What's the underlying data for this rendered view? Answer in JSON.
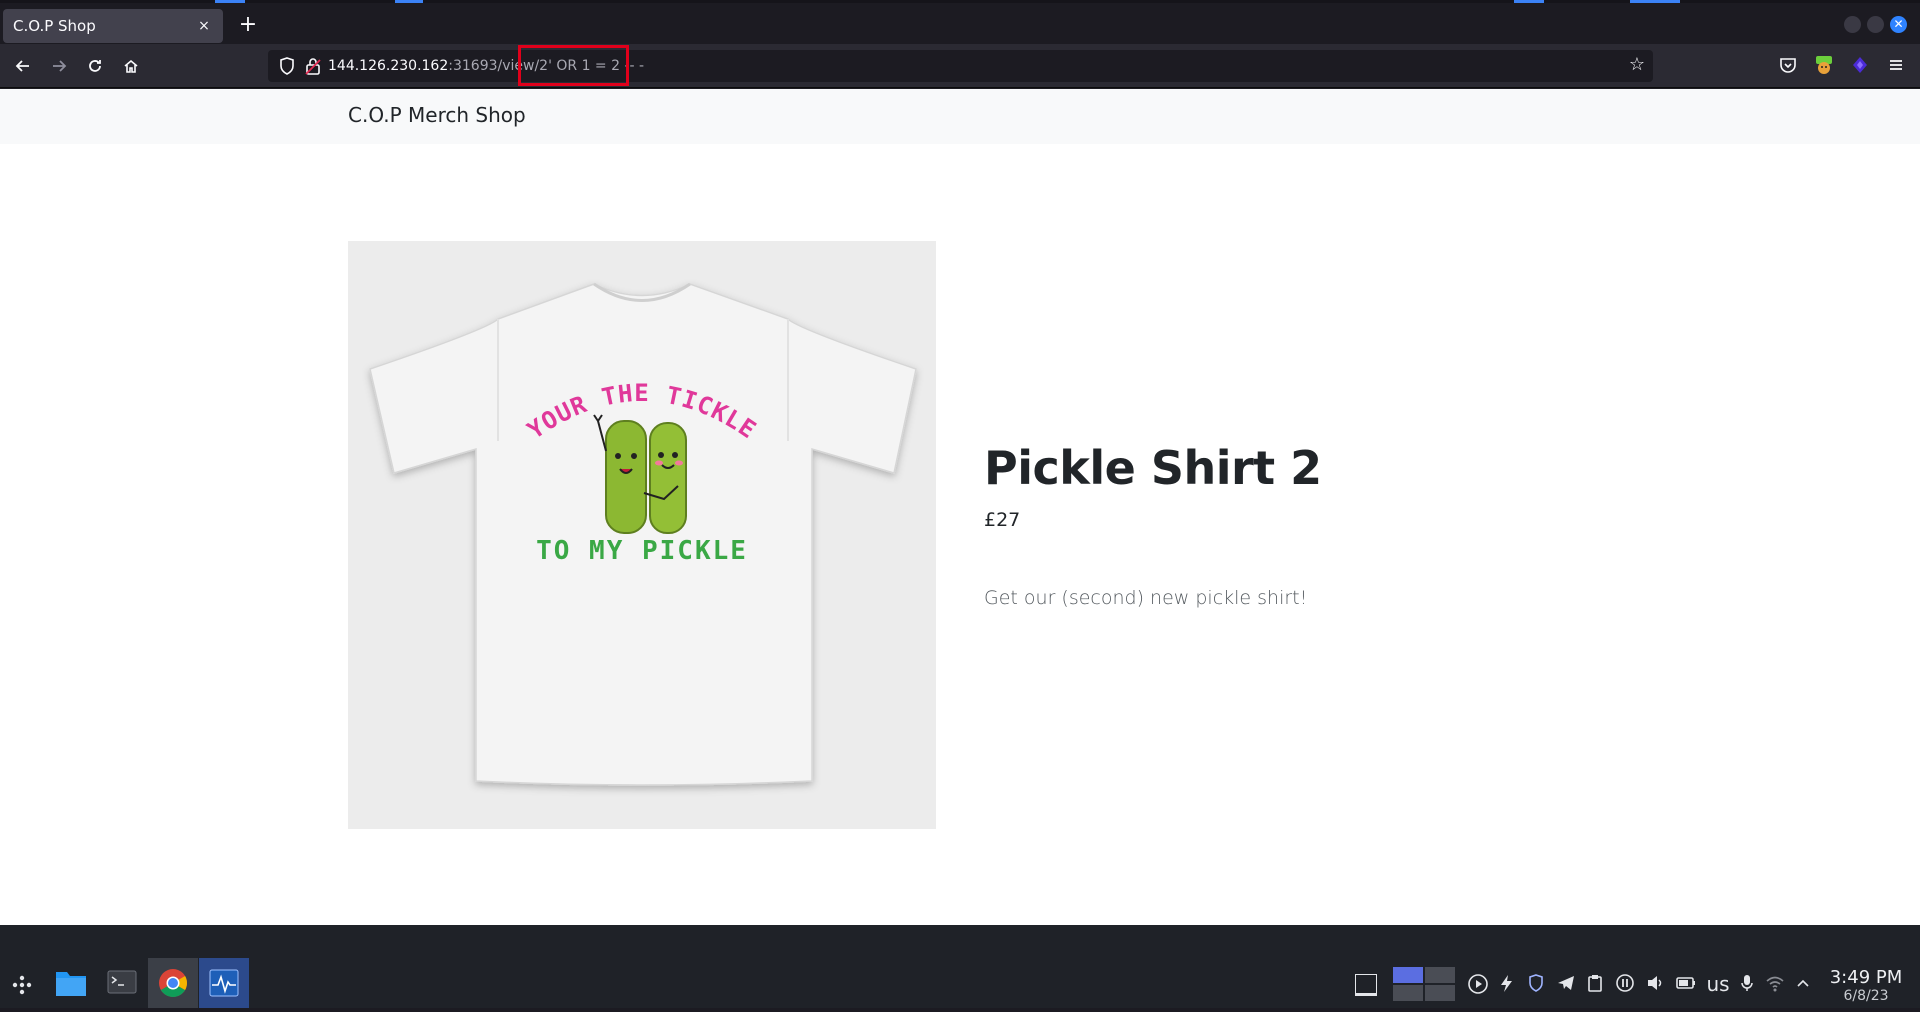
{
  "browser": {
    "tab": {
      "title": "C.O.P Shop",
      "close_glyph": "×"
    },
    "new_tab_glyph": "+",
    "url": {
      "host": "144.126.230.162",
      "rest": ":31693/view/2' OR 1 = 2 -- -"
    },
    "icons": [
      "back-icon",
      "forward-icon",
      "reload-icon",
      "home-icon",
      "shield-icon",
      "lock-icon",
      "star-icon",
      "pocket-icon",
      "burp-icon",
      "extension-icon",
      "menu-icon"
    ]
  },
  "site": {
    "brand": "C.O.P Merch Shop"
  },
  "product": {
    "title": "Pickle Shirt 2",
    "price": "£27",
    "description": "Get our (second) new pickle shirt!",
    "shirt_text_top": "YOUR THE TICKLE",
    "shirt_text_bottom": "TO MY PICKLE"
  },
  "taskbar": {
    "keyboard_layout": "us",
    "time": "3:49 PM",
    "date": "6/8/23"
  },
  "colors": {
    "highlight_box": "#e0001b",
    "shirt_pink": "#e0389a",
    "shirt_green": "#3aa845",
    "pickle": "#8cb832"
  }
}
